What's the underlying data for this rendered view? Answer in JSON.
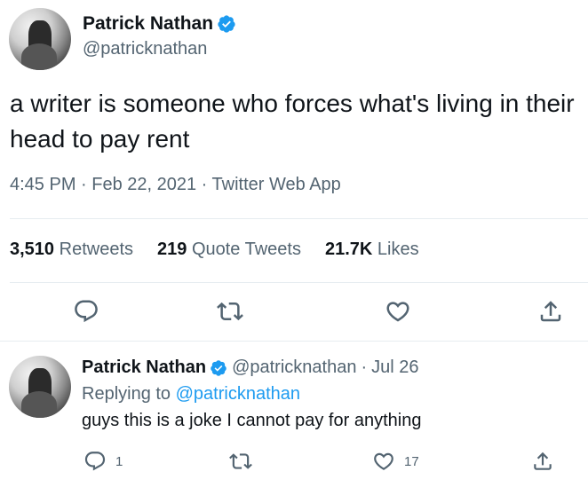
{
  "main_tweet": {
    "author_name": "Patrick Nathan",
    "author_handle": "@patricknathan",
    "text": "a writer is someone who forces what's living in their head to pay rent",
    "time": "4:45 PM · Feb 22, 2021 · Twitter Web App",
    "stats": [
      {
        "count": "3,510",
        "label": "Retweets"
      },
      {
        "count": "219",
        "label": "Quote Tweets"
      },
      {
        "count": "21.7K",
        "label": "Likes"
      }
    ],
    "actions": [
      "reply-icon",
      "retweet-icon",
      "like-icon",
      "share-icon"
    ]
  },
  "reply_tweet": {
    "author_name": "Patrick Nathan",
    "author_handle": "@patricknathan",
    "dot": "·",
    "date": "Jul 26",
    "replying_prefix": "Replying to",
    "replying_to": "@patricknathan",
    "text": "guys this is a joke I cannot pay for anything",
    "reply_count": "1",
    "like_count": "17"
  },
  "colors": {
    "accent": "#1d9bf0",
    "text": "#0f1419",
    "muted": "#536471",
    "divider": "#e6ecf0"
  }
}
